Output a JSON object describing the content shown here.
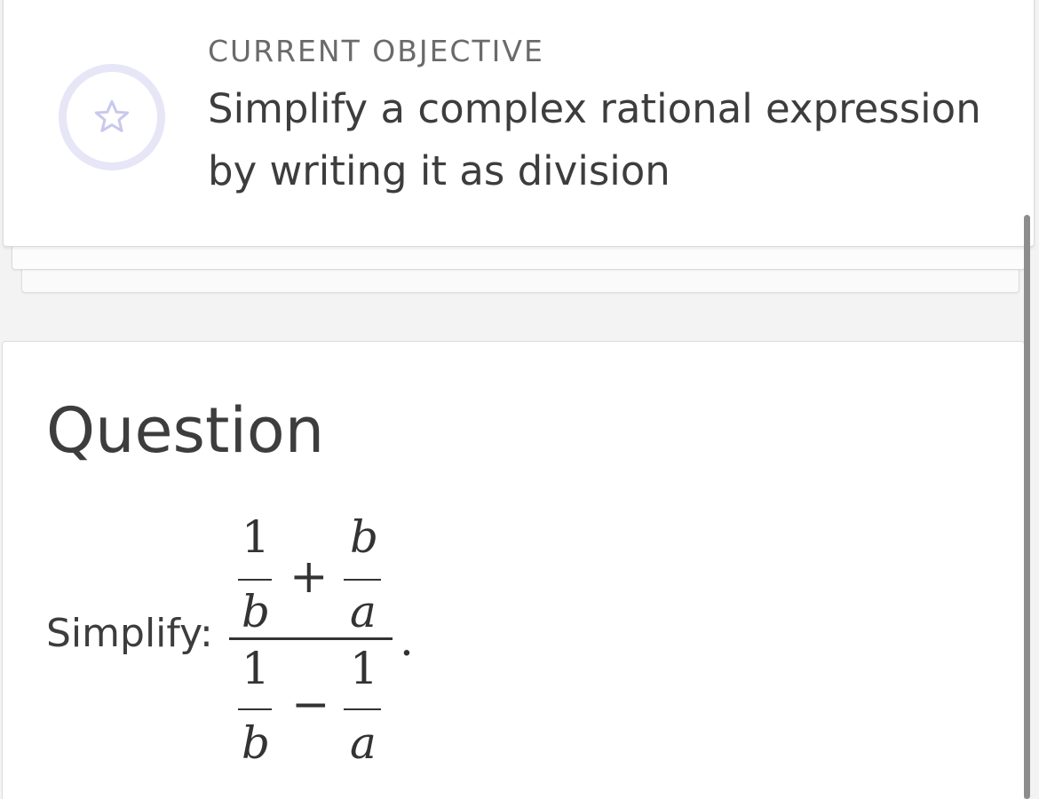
{
  "objective": {
    "kicker": "CURRENT OBJECTIVE",
    "title": "Simplify a complex rational expression by writing it as division",
    "icon": "star-icon"
  },
  "question": {
    "heading": "Question",
    "prompt_label": "Simplify:",
    "expression": {
      "numerator": {
        "left": {
          "num": "1",
          "den": "b"
        },
        "operator": "+",
        "right": {
          "num": "b",
          "den": "a"
        }
      },
      "denominator": {
        "left": {
          "num": "1",
          "den": "b"
        },
        "operator": "−",
        "right": {
          "num": "1",
          "den": "a"
        }
      },
      "trailing": "."
    }
  },
  "colors": {
    "icon_ring": "#e6e6f7",
    "icon_star": "#c9c9ee",
    "text_primary": "#3d3d3d",
    "text_secondary": "#6a6a6a"
  }
}
